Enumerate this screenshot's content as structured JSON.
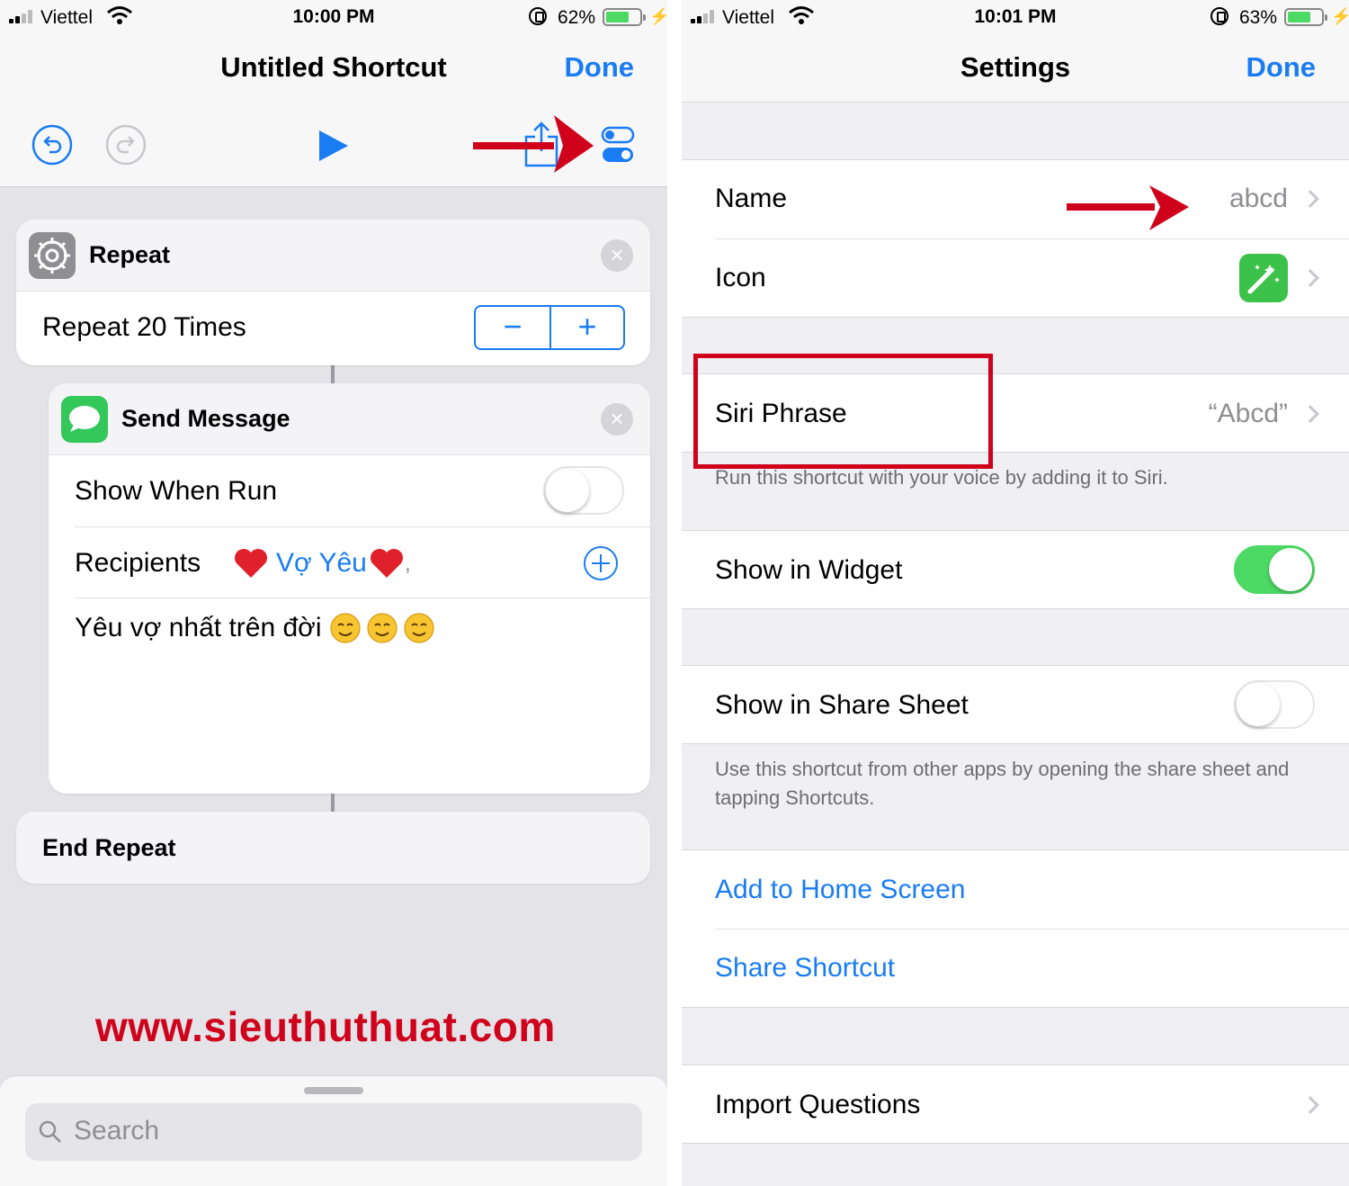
{
  "left_screen": {
    "status": {
      "carrier": "Viettel",
      "time": "10:00 PM",
      "battery": "62%"
    },
    "nav": {
      "title": "Untitled Shortcut",
      "done": "Done"
    },
    "repeat_block": {
      "title": "Repeat",
      "count_label": "Repeat 20 Times",
      "minus": "−",
      "plus": "+"
    },
    "send_message": {
      "title": "Send Message",
      "show_when_run": "Show When Run",
      "show_when_run_on": false,
      "recipients_label": "Recipients",
      "recipient_name": "Vợ Yêu",
      "recipient_suffix": ",",
      "message": "Yêu vợ nhất trên đời"
    },
    "end_repeat": {
      "title": "End Repeat"
    },
    "watermark": "www.sieuthuthuat.com",
    "search": {
      "placeholder": "Search"
    }
  },
  "right_screen": {
    "status": {
      "carrier": "Viettel",
      "time": "10:01 PM",
      "battery": "63%"
    },
    "nav": {
      "title": "Settings",
      "done": "Done"
    },
    "name": {
      "label": "Name",
      "value": "abcd"
    },
    "icon": {
      "label": "Icon"
    },
    "siri_phrase": {
      "label": "Siri Phrase",
      "value": "“Abcd”",
      "footnote": "Run this shortcut with your voice by adding it to Siri."
    },
    "widget": {
      "label": "Show in Widget",
      "on": true
    },
    "share_sheet": {
      "label": "Show in Share Sheet",
      "on": false,
      "footnote": "Use this shortcut from other apps by opening the share sheet and tapping Shortcuts."
    },
    "links": {
      "add_home": "Add to Home Screen",
      "share": "Share Shortcut"
    },
    "import": {
      "label": "Import Questions"
    }
  },
  "colors": {
    "accent": "#1a7cf3",
    "toggle_on": "#4cd964",
    "annotation": "#d0021b"
  },
  "icons": [
    "undo-icon",
    "redo-icon",
    "play-icon",
    "share-icon",
    "settings-toggles-icon",
    "gear-icon",
    "messages-icon",
    "close-icon",
    "add-circle-icon",
    "search-icon",
    "magic-wand-icon",
    "chevron-right-icon",
    "red-arrow-icon"
  ]
}
